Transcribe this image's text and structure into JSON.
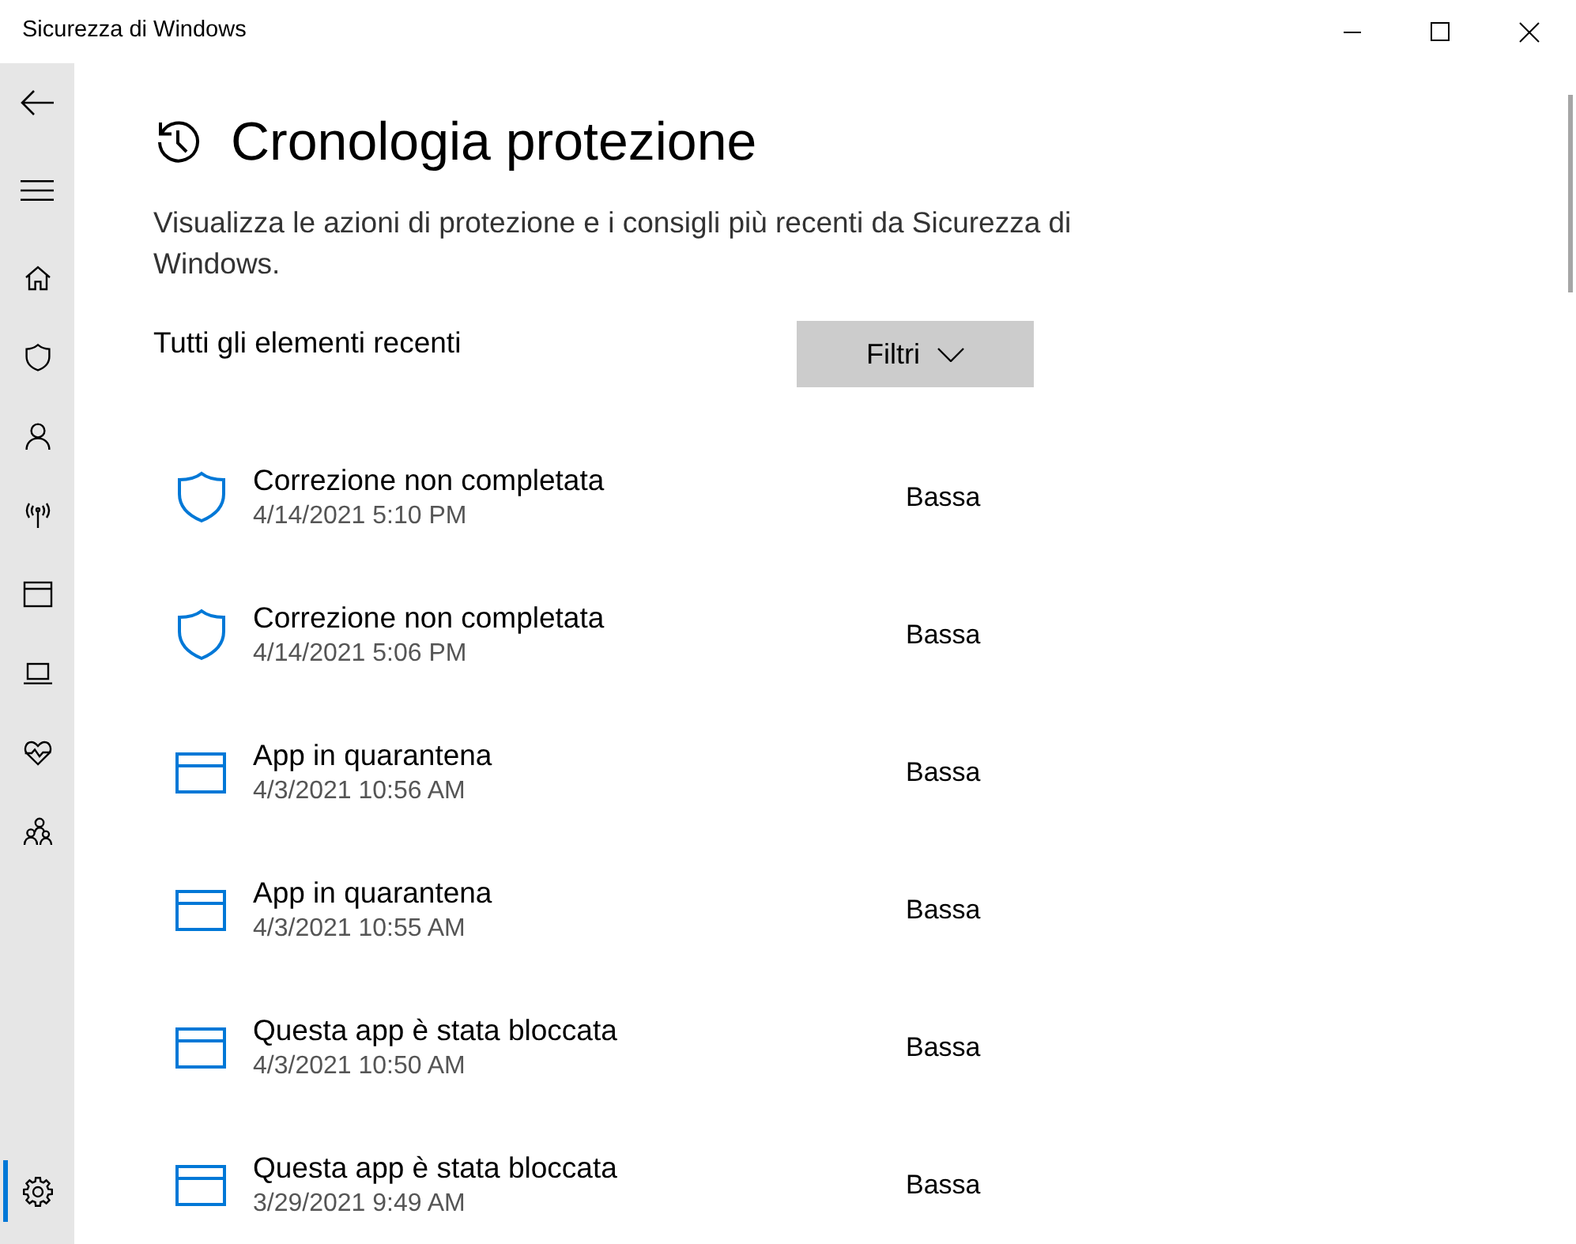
{
  "window": {
    "title": "Sicurezza di Windows"
  },
  "sidebar": {
    "items": [
      {
        "kind": "home",
        "selected": false
      },
      {
        "kind": "shield",
        "selected": false
      },
      {
        "kind": "account",
        "selected": false
      },
      {
        "kind": "network",
        "selected": false
      },
      {
        "kind": "app",
        "selected": false
      },
      {
        "kind": "device",
        "selected": false
      },
      {
        "kind": "health",
        "selected": false
      },
      {
        "kind": "family",
        "selected": false
      },
      {
        "kind": "settings",
        "selected": true
      }
    ]
  },
  "page": {
    "title": "Cronologia protezione",
    "description": "Visualizza le azioni di protezione e i consigli più recenti da Sicurezza di Windows."
  },
  "filter": {
    "label": "Tutti gli elementi recenti",
    "button": "Filtri"
  },
  "history": [
    {
      "kind": "shield",
      "title": "Correzione non completata",
      "date": "4/14/2021 5:10 PM",
      "severity": "Bassa"
    },
    {
      "kind": "shield",
      "title": "Correzione non completata",
      "date": "4/14/2021 5:06 PM",
      "severity": "Bassa"
    },
    {
      "kind": "app",
      "title": "App in quarantena",
      "date": "4/3/2021 10:56 AM",
      "severity": "Bassa"
    },
    {
      "kind": "app",
      "title": "App in quarantena",
      "date": "4/3/2021 10:55 AM",
      "severity": "Bassa"
    },
    {
      "kind": "app",
      "title": "Questa app è stata bloccata",
      "date": "4/3/2021 10:50 AM",
      "severity": "Bassa"
    },
    {
      "kind": "app",
      "title": "Questa app è stata bloccata",
      "date": "3/29/2021 9:49 AM",
      "severity": "Bassa"
    }
  ]
}
